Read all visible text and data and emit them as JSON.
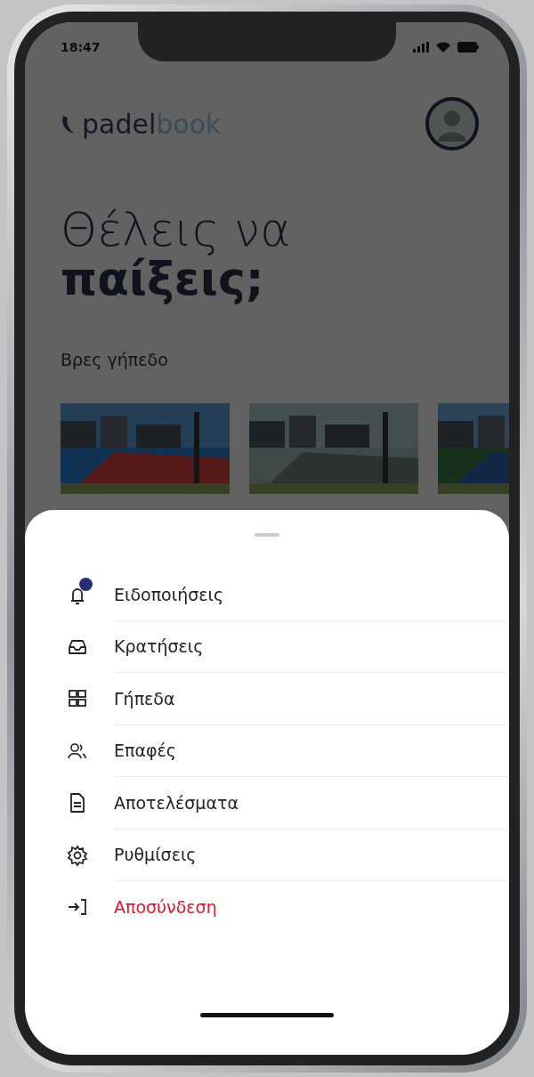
{
  "status_bar": {
    "time": "18:47"
  },
  "header": {
    "logo_dark": "padel",
    "logo_light": "book"
  },
  "headline": {
    "line_1": "Θέλεις να",
    "line_2": "παίξεις;"
  },
  "section": {
    "title": "Βρες γήπεδο"
  },
  "menu": [
    {
      "label": "Ειδοποιήσεις",
      "kind": "default",
      "has_badge": true
    },
    {
      "label": "Κρατήσεις",
      "kind": "default",
      "has_badge": false
    },
    {
      "label": "Γήπεδα",
      "kind": "default",
      "has_badge": false
    },
    {
      "label": "Επαφές",
      "kind": "default",
      "has_badge": false
    },
    {
      "label": "Αποτελέσματα",
      "kind": "default",
      "has_badge": false
    },
    {
      "label": "Ρυθμίσεις",
      "kind": "default",
      "has_badge": false
    },
    {
      "label": "Αποσύνδεση",
      "kind": "danger",
      "has_badge": false
    }
  ]
}
